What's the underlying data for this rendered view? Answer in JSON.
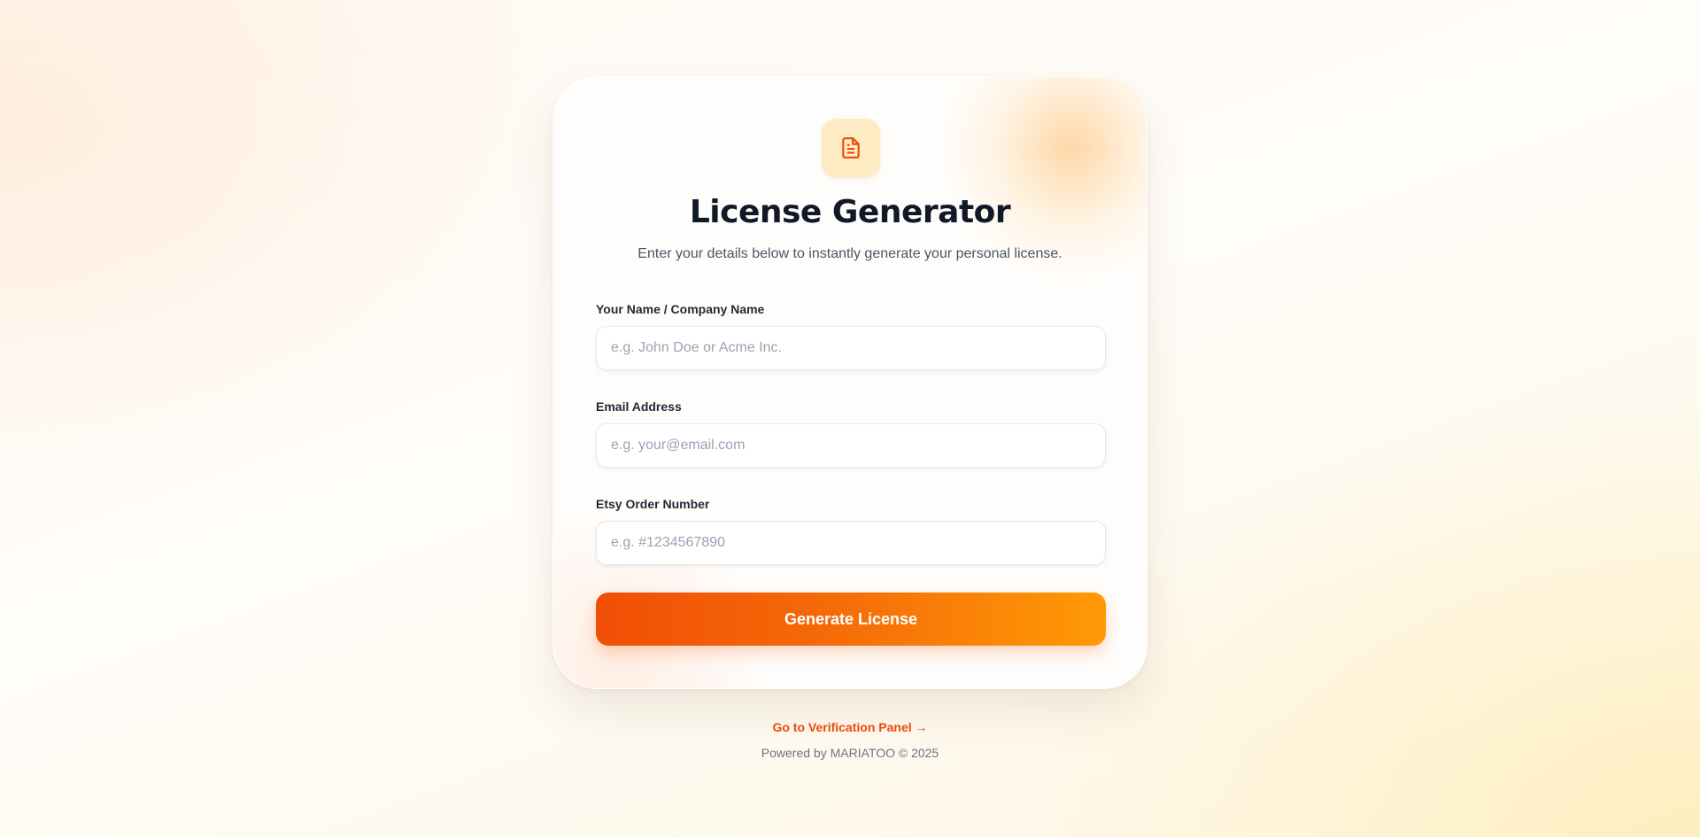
{
  "header": {
    "icon": "document-text-icon",
    "title": "License Generator",
    "subtitle": "Enter your details below to instantly generate your personal license."
  },
  "form": {
    "name": {
      "label": "Your Name / Company Name",
      "placeholder": "e.g. John Doe or Acme Inc.",
      "value": ""
    },
    "email": {
      "label": "Email Address",
      "placeholder": "e.g. your@email.com",
      "value": ""
    },
    "order": {
      "label": "Etsy Order Number",
      "placeholder": "e.g. #1234567890",
      "value": ""
    },
    "submit_label": "Generate License"
  },
  "footer": {
    "link_label": "Go to Verification Panel →",
    "powered_by": "Powered by MARIATOO © 2025"
  },
  "colors": {
    "accent": "#ea4a0b",
    "button_start": "#f04e06",
    "button_end": "#ff9a06",
    "icon_bg": "#fdebc3"
  }
}
